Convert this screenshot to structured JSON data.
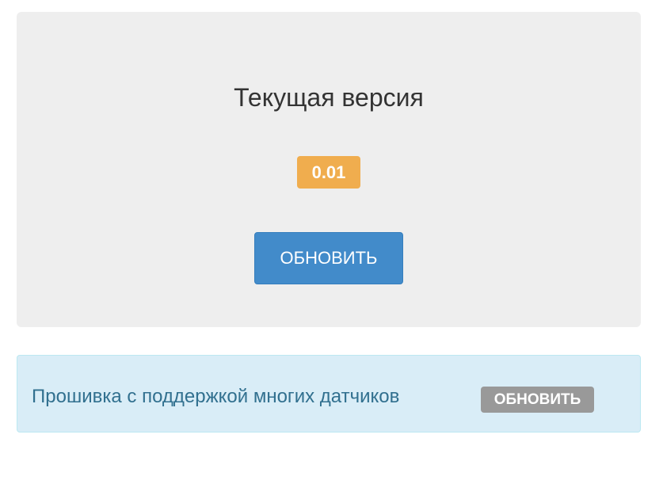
{
  "current_version": {
    "title": "Текущая версия",
    "version": "0.01",
    "update_button_label": "ОБНОВИТЬ"
  },
  "firmware": {
    "description": "Прошивка с поддержкой многих датчиков",
    "update_button_label": "ОБНОВИТЬ"
  },
  "colors": {
    "panel_background": "#eeeeee",
    "version_badge": "#f0ad4e",
    "primary_button": "#428bca",
    "info_background": "#d9edf7",
    "info_text": "#31708f",
    "secondary_button": "#999999"
  }
}
